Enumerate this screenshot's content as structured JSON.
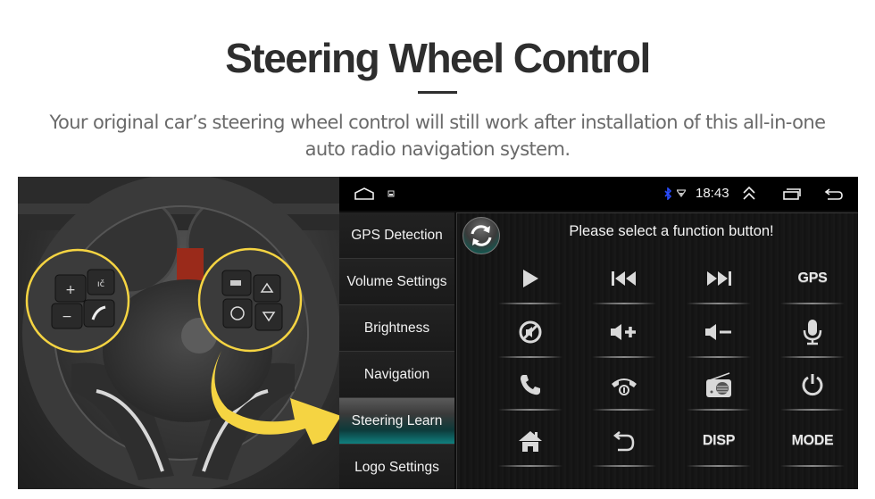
{
  "header": {
    "title": "Steering Wheel Control",
    "subtitle_line1": "Your original car’s steering wheel control will still work after installation of this all-in-one",
    "subtitle_line2": "auto radio navigation system."
  },
  "photo": {
    "description": "steering-wheel-with-highlighted-buttons",
    "accent_color": "#f5d442",
    "left_buttons": [
      "+",
      "−",
      "voice",
      "phone"
    ],
    "right_buttons": [
      "mode",
      "up",
      "ok",
      "down"
    ]
  },
  "statusbar": {
    "time": "18:43",
    "icons": [
      "home-icon",
      "screenshot-icon",
      "bluetooth-icon",
      "wifi-icon",
      "expand-up-icon",
      "recent-apps-icon",
      "back-icon"
    ]
  },
  "menu": {
    "items": [
      {
        "label": "GPS Detection",
        "active": false
      },
      {
        "label": "Volume Settings",
        "active": false
      },
      {
        "label": "Brightness",
        "active": false
      },
      {
        "label": "Navigation",
        "active": false
      },
      {
        "label": "Steering Learn",
        "active": true
      },
      {
        "label": "Logo Settings",
        "active": false
      }
    ]
  },
  "panel": {
    "prompt": "Please select a function button!",
    "buttons": [
      {
        "name": "play",
        "icon": "play-icon",
        "label": ""
      },
      {
        "name": "previous",
        "icon": "previous-track-icon",
        "label": ""
      },
      {
        "name": "next",
        "icon": "next-track-icon",
        "label": ""
      },
      {
        "name": "gps",
        "icon": "",
        "label": "GPS"
      },
      {
        "name": "mute",
        "icon": "mute-icon",
        "label": ""
      },
      {
        "name": "volume-up",
        "icon": "volume-up-icon",
        "label": ""
      },
      {
        "name": "volume-down",
        "icon": "volume-down-icon",
        "label": ""
      },
      {
        "name": "voice",
        "icon": "microphone-icon",
        "label": ""
      },
      {
        "name": "answer-call",
        "icon": "phone-icon",
        "label": ""
      },
      {
        "name": "hang-up",
        "icon": "hang-up-icon",
        "label": ""
      },
      {
        "name": "radio",
        "icon": "radio-icon",
        "label": ""
      },
      {
        "name": "power",
        "icon": "power-icon",
        "label": ""
      },
      {
        "name": "home",
        "icon": "home-icon",
        "label": ""
      },
      {
        "name": "back",
        "icon": "back-icon",
        "label": ""
      },
      {
        "name": "disp",
        "icon": "",
        "label": "DISP"
      },
      {
        "name": "mode",
        "icon": "",
        "label": "MODE"
      }
    ]
  }
}
